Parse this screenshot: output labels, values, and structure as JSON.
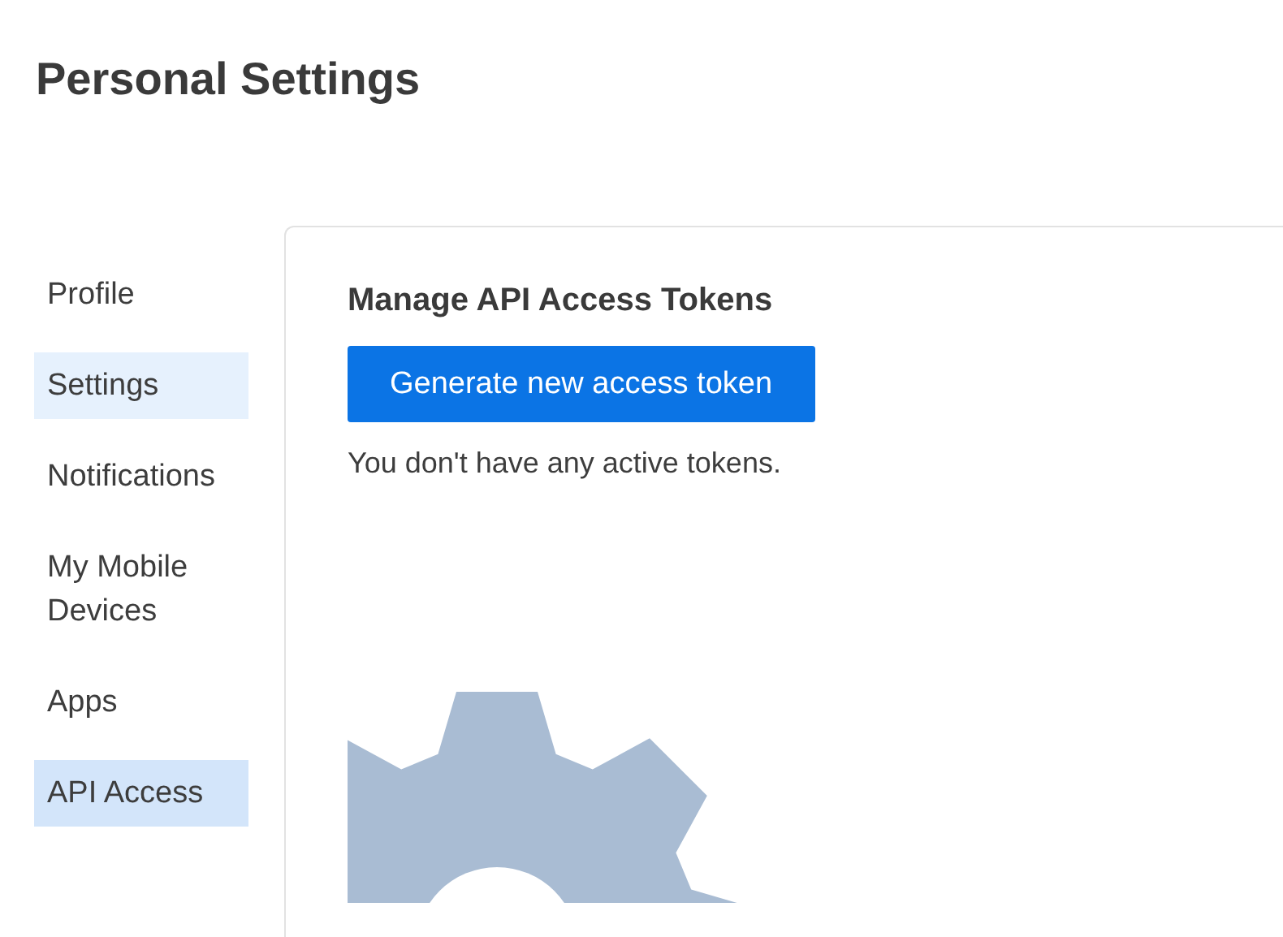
{
  "page_title": "Personal Settings",
  "sidebar": {
    "items": [
      {
        "label": "Profile",
        "selected": false,
        "hovered": false
      },
      {
        "label": "Settings",
        "selected": false,
        "hovered": true
      },
      {
        "label": "Notifications",
        "selected": false,
        "hovered": false
      },
      {
        "label": "My Mobile Devices",
        "selected": false,
        "hovered": false
      },
      {
        "label": "Apps",
        "selected": false,
        "hovered": false
      },
      {
        "label": "API Access",
        "selected": true,
        "hovered": false
      }
    ]
  },
  "panel": {
    "heading": "Manage API Access Tokens",
    "button": "Generate new access token",
    "message": "You don't have any active tokens."
  }
}
